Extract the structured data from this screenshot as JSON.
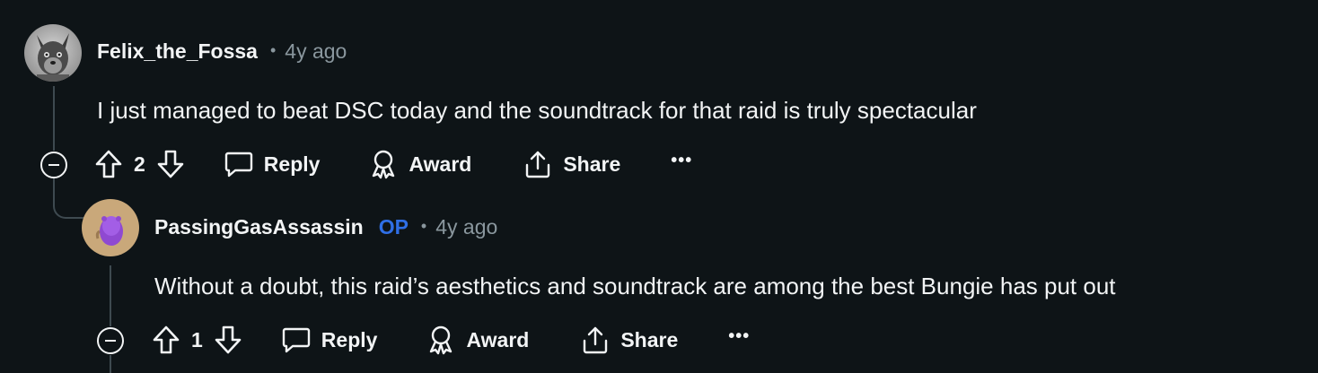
{
  "comments": [
    {
      "username": "Felix_the_Fossa",
      "op_badge": "",
      "separator": "•",
      "timestamp": "4y ago",
      "body": "I just managed to beat DSC today and the soundtrack for that raid is truly spectacular",
      "score": "2",
      "avatar_icon": "fossa-avatar-icon"
    },
    {
      "username": "PassingGasAssassin",
      "op_badge": "OP",
      "separator": "•",
      "timestamp": "4y ago",
      "body": "Without a doubt, this raid’s aesthetics and soundtrack are among the best Bungie has put out",
      "score": "1",
      "avatar_icon": "snoo-avatar-icon"
    }
  ],
  "actions": {
    "reply_label": "Reply",
    "award_label": "Award",
    "share_label": "Share",
    "more_label": "•••"
  },
  "colors": {
    "background": "#0e1417",
    "text": "#f2f4f5",
    "muted": "#8a979e",
    "op": "#2f6fe6",
    "thread_line": "#3e4a50"
  },
  "icons": {
    "upvote": "upvote-arrow-icon",
    "downvote": "downvote-arrow-icon",
    "reply": "speech-bubble-icon",
    "award": "award-ribbon-icon",
    "share": "share-upload-icon",
    "collapse": "collapse-minus-icon"
  }
}
